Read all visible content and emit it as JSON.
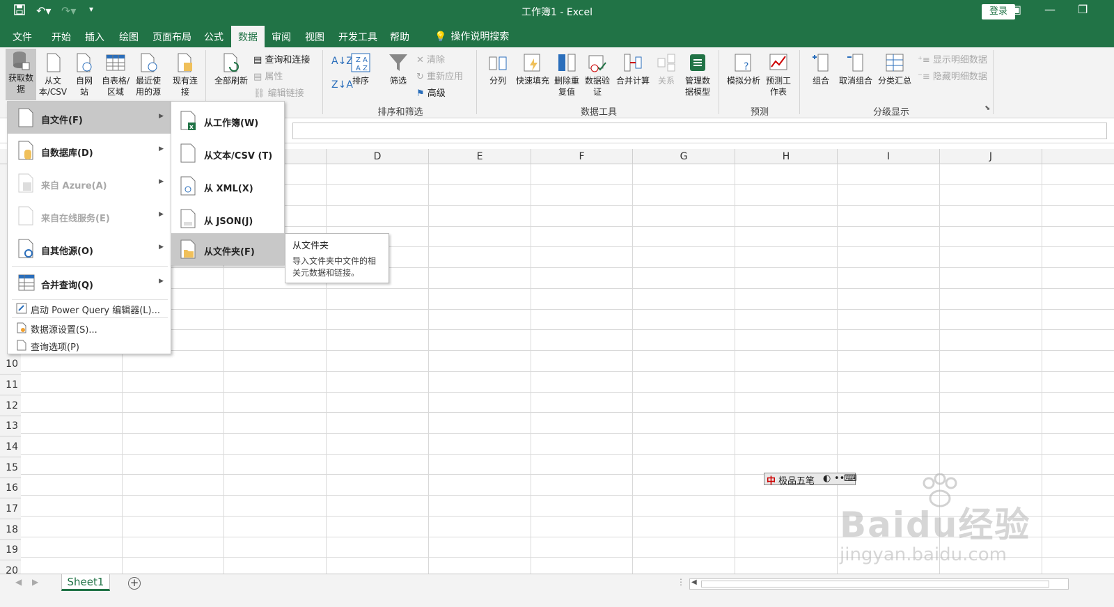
{
  "window": {
    "title": "工作簿1  -  Excel",
    "login": "登录"
  },
  "tabs": [
    "文件",
    "开始",
    "插入",
    "绘图",
    "页面布局",
    "公式",
    "数据",
    "审阅",
    "视图",
    "开发工具",
    "帮助"
  ],
  "active_tab": "数据",
  "tell_me": "操作说明搜索",
  "ribbon": {
    "get_data": "获取数据",
    "from_text_csv": "从文本/CSV",
    "from_web": "自网站",
    "from_table": "自表格/区域",
    "recent_sources": "最近使用的源",
    "existing_conn": "现有连接",
    "refresh_all": "全部刷新",
    "queries_conn": "查询和连接",
    "properties": "属性",
    "edit_links": "编辑链接",
    "sort": "排序",
    "filter": "筛选",
    "clear": "清除",
    "reapply": "重新应用",
    "advanced": "高级",
    "sort_filter_group": "排序和筛选",
    "text_to_columns": "分列",
    "flash_fill": "快速填充",
    "remove_dup": "删除重复值",
    "data_validation": "数据验证",
    "consolidate": "合并计算",
    "relationships": "关系",
    "manage_model": "管理数据模型",
    "data_tools_group": "数据工具",
    "what_if": "模拟分析",
    "forecast_sheet": "预测工作表",
    "forecast_group": "预测",
    "group": "组合",
    "ungroup": "取消组合",
    "subtotal": "分类汇总",
    "show_detail": "显示明细数据",
    "hide_detail": "隐藏明细数据",
    "outline_group": "分级显示"
  },
  "columns": [
    "D",
    "E",
    "F",
    "G",
    "H",
    "I",
    "J"
  ],
  "rows": [
    "10",
    "11",
    "12",
    "13",
    "14",
    "15",
    "16",
    "17",
    "18",
    "19",
    "20"
  ],
  "menu1": {
    "items": [
      {
        "label": "自文件(F)",
        "disabled": false
      },
      {
        "label": "自数据库(D)",
        "disabled": false
      },
      {
        "label": "来自 Azure(A)",
        "disabled": true
      },
      {
        "label": "来自在线服务(E)",
        "disabled": true
      },
      {
        "label": "自其他源(O)",
        "disabled": false
      },
      {
        "label": "合并查询(Q)",
        "disabled": false
      }
    ],
    "small": [
      "启动 Power Query 编辑器(L)...",
      "数据源设置(S)...",
      "查询选项(P)"
    ]
  },
  "menu2": {
    "items": [
      "从工作簿(W)",
      "从文本/CSV (T)",
      "从 XML(X)",
      "从 JSON(J)",
      "从文件夹(F)"
    ]
  },
  "tooltip": {
    "title": "从文件夹",
    "body": "导入文件夹中文件的相关元数据和链接。"
  },
  "ime": {
    "label": "极品五笔"
  },
  "watermark": {
    "main": "Baidu经验",
    "sub": "jingyan.baidu.com"
  },
  "sheet": {
    "tab": "Sheet1"
  },
  "colors": {
    "accent": "#217346"
  }
}
